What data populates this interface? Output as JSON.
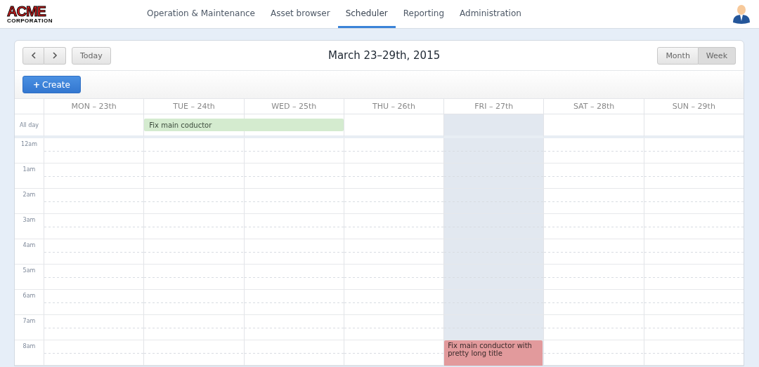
{
  "logo": {
    "name": "ACME",
    "subtitle": "CORPORATION"
  },
  "nav": [
    {
      "label": "Operation & Maintenance",
      "selected": false
    },
    {
      "label": "Asset browser",
      "selected": false
    },
    {
      "label": "Scheduler",
      "selected": true
    },
    {
      "label": "Reporting",
      "selected": false
    },
    {
      "label": "Administration",
      "selected": false
    }
  ],
  "toolbar": {
    "today": "Today",
    "title": "March 23–29th, 2015",
    "views": [
      {
        "label": "Month",
        "selected": false
      },
      {
        "label": "Week",
        "selected": true
      }
    ],
    "create": "Create",
    "create_icon": "+"
  },
  "days": [
    "MON – 23th",
    "TUE – 24th",
    "WED – 25th",
    "THU – 26th",
    "FRI – 27th",
    "SAT – 28th",
    "SUN – 29th"
  ],
  "all_day": {
    "label": "All day",
    "cells": [
      {
        "today": false,
        "continued": false
      },
      {
        "today": false,
        "continued": false,
        "event": {
          "title": "Fix main coductor",
          "color": "#d4ebcf"
        }
      },
      {
        "today": false,
        "continued": true
      },
      {
        "today": false,
        "continued": false
      },
      {
        "today": true,
        "continued": false
      },
      {
        "today": false,
        "continued": false
      },
      {
        "today": false,
        "continued": false
      }
    ]
  },
  "hours": [
    {
      "label": "12am",
      "cells": [
        {
          "today": false
        },
        {
          "today": false
        },
        {
          "today": false
        },
        {
          "today": false
        },
        {
          "today": true
        },
        {
          "today": false
        },
        {
          "today": false
        }
      ]
    },
    {
      "label": "1am",
      "cells": [
        {
          "today": false
        },
        {
          "today": false
        },
        {
          "today": false
        },
        {
          "today": false
        },
        {
          "today": true
        },
        {
          "today": false
        },
        {
          "today": false
        }
      ]
    },
    {
      "label": "2am",
      "cells": [
        {
          "today": false
        },
        {
          "today": false
        },
        {
          "today": false
        },
        {
          "today": false
        },
        {
          "today": true
        },
        {
          "today": false
        },
        {
          "today": false
        }
      ]
    },
    {
      "label": "3am",
      "cells": [
        {
          "today": false
        },
        {
          "today": false
        },
        {
          "today": false
        },
        {
          "today": false
        },
        {
          "today": true
        },
        {
          "today": false
        },
        {
          "today": false
        }
      ]
    },
    {
      "label": "4am",
      "cells": [
        {
          "today": false
        },
        {
          "today": false
        },
        {
          "today": false
        },
        {
          "today": false
        },
        {
          "today": true
        },
        {
          "today": false
        },
        {
          "today": false
        }
      ]
    },
    {
      "label": "5am",
      "cells": [
        {
          "today": false
        },
        {
          "today": false
        },
        {
          "today": false
        },
        {
          "today": false
        },
        {
          "today": true
        },
        {
          "today": false
        },
        {
          "today": false
        }
      ]
    },
    {
      "label": "6am",
      "cells": [
        {
          "today": false
        },
        {
          "today": false
        },
        {
          "today": false
        },
        {
          "today": false
        },
        {
          "today": true
        },
        {
          "today": false
        },
        {
          "today": false
        }
      ]
    },
    {
      "label": "7am",
      "cells": [
        {
          "today": false
        },
        {
          "today": false
        },
        {
          "today": false
        },
        {
          "today": false
        },
        {
          "today": true
        },
        {
          "today": false
        },
        {
          "today": false
        }
      ]
    },
    {
      "label": "8am",
      "cells": [
        {
          "today": false
        },
        {
          "today": false
        },
        {
          "today": false
        },
        {
          "today": false
        },
        {
          "today": true,
          "event": {
            "title": "Fix main conductor with pretty long title",
            "color": "#e29a9c"
          }
        },
        {
          "today": false
        },
        {
          "today": false
        }
      ]
    }
  ]
}
